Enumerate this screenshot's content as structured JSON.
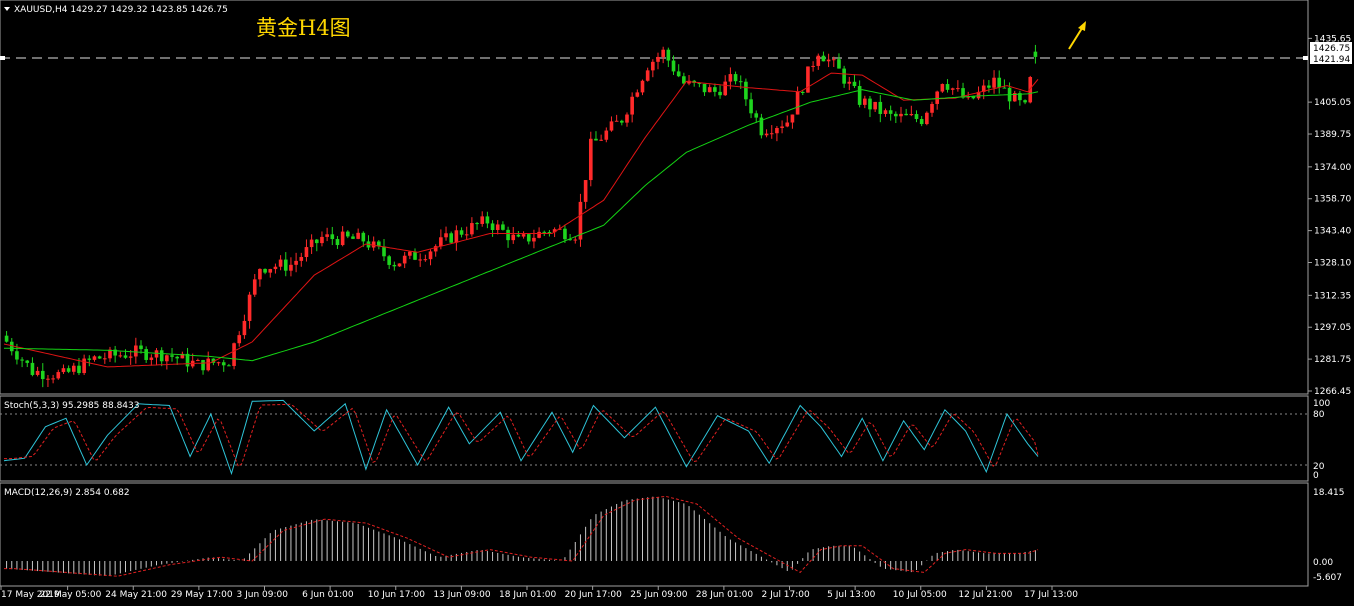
{
  "chart": {
    "symbol_line": "XAUUSD,H4  1429.27 1429.32 1423.85 1426.75",
    "title": "黄金H4图",
    "current_price": "1426.75",
    "line_price": "1421.94",
    "price_axis_labels": [
      "1435.65",
      "1405.05",
      "1389.75",
      "1374.00",
      "1358.70",
      "1343.40",
      "1328.10",
      "1312.35",
      "1297.05",
      "1281.75",
      "1266.45"
    ],
    "time_labels": [
      "17 May 2019",
      "22 May 05:00",
      "24 May 21:00",
      "29 May 17:00",
      "3 Jun 09:00",
      "6 Jun 01:00",
      "10 Jun 17:00",
      "13 Jun 09:00",
      "18 Jun 01:00",
      "20 Jun 17:00",
      "25 Jun 09:00",
      "28 Jun 01:00",
      "2 Jul 17:00",
      "5 Jul 13:00",
      "10 Jul 05:00",
      "12 Jul 21:00",
      "17 Jul 13:00"
    ]
  },
  "stoch": {
    "label": "Stoch(5,3,3) 95.2985 88.8433",
    "levels": [
      "100",
      "80",
      "20",
      "0"
    ]
  },
  "macd": {
    "label": "MACD(12,26,9) 2.854 0.682",
    "levels": [
      "18.415",
      "0.00",
      "-5.607"
    ]
  },
  "colors": {
    "background": "#000000",
    "bull_candle": "#ff2a2a",
    "bear_candle": "#1ed41e",
    "fast_ma": "#e01414",
    "slow_ma": "#14d414",
    "stoch_main": "#2ec4d8",
    "stoch_signal": "#e02020",
    "macd_hist": "#c8c8c8",
    "macd_signal": "#e02020",
    "title": "#ffd700",
    "arrow": "#ffd700"
  },
  "chart_data": {
    "type": "candlestick",
    "symbol": "XAUUSD",
    "timeframe": "H4",
    "ohlc_last": {
      "open": 1429.27,
      "high": 1429.32,
      "low": 1423.85,
      "close": 1426.75
    },
    "ylim": [
      1266.45,
      1443.5
    ],
    "close_path": [
      [
        0,
        1293
      ],
      [
        0.03,
        1276
      ],
      [
        0.06,
        1274
      ],
      [
        0.09,
        1282
      ],
      [
        0.13,
        1285
      ],
      [
        0.16,
        1284
      ],
      [
        0.19,
        1279
      ],
      [
        0.22,
        1281
      ],
      [
        0.25,
        1326
      ],
      [
        0.28,
        1327
      ],
      [
        0.31,
        1340
      ],
      [
        0.35,
        1339
      ],
      [
        0.38,
        1328
      ],
      [
        0.41,
        1333
      ],
      [
        0.44,
        1342
      ],
      [
        0.47,
        1348
      ],
      [
        0.5,
        1338
      ],
      [
        0.53,
        1344
      ],
      [
        0.555,
        1342
      ],
      [
        0.57,
        1384
      ],
      [
        0.6,
        1397
      ],
      [
        0.625,
        1423
      ],
      [
        0.64,
        1429
      ],
      [
        0.66,
        1414
      ],
      [
        0.69,
        1410
      ],
      [
        0.71,
        1417
      ],
      [
        0.735,
        1392
      ],
      [
        0.76,
        1396
      ],
      [
        0.79,
        1430
      ],
      [
        0.81,
        1420
      ],
      [
        0.83,
        1406
      ],
      [
        0.86,
        1398
      ],
      [
        0.89,
        1397
      ],
      [
        0.91,
        1416
      ],
      [
        0.935,
        1405
      ],
      [
        0.96,
        1415
      ],
      [
        0.98,
        1406
      ],
      [
        0.99,
        1402
      ],
      [
        1.0,
        1428
      ]
    ],
    "fast_ma_path": [
      [
        0,
        1289
      ],
      [
        0.1,
        1278
      ],
      [
        0.2,
        1280
      ],
      [
        0.24,
        1290
      ],
      [
        0.3,
        1322
      ],
      [
        0.35,
        1337
      ],
      [
        0.4,
        1333
      ],
      [
        0.47,
        1342
      ],
      [
        0.53,
        1342
      ],
      [
        0.58,
        1358
      ],
      [
        0.62,
        1388
      ],
      [
        0.66,
        1415
      ],
      [
        0.72,
        1412
      ],
      [
        0.77,
        1410
      ],
      [
        0.8,
        1419
      ],
      [
        0.83,
        1418
      ],
      [
        0.87,
        1406
      ],
      [
        0.92,
        1407
      ],
      [
        0.97,
        1413
      ],
      [
        0.99,
        1410
      ],
      [
        1.0,
        1416
      ]
    ],
    "slow_ma_path": [
      [
        0,
        1287
      ],
      [
        0.1,
        1286
      ],
      [
        0.2,
        1283
      ],
      [
        0.24,
        1281
      ],
      [
        0.3,
        1290
      ],
      [
        0.38,
        1306
      ],
      [
        0.46,
        1322
      ],
      [
        0.52,
        1334
      ],
      [
        0.58,
        1346
      ],
      [
        0.62,
        1365
      ],
      [
        0.66,
        1381
      ],
      [
        0.72,
        1394
      ],
      [
        0.78,
        1405
      ],
      [
        0.83,
        1411
      ],
      [
        0.88,
        1406
      ],
      [
        0.94,
        1408
      ],
      [
        0.99,
        1409
      ],
      [
        1.0,
        1410
      ]
    ],
    "stoch_main_path": [
      [
        0,
        25
      ],
      [
        0.02,
        28
      ],
      [
        0.04,
        65
      ],
      [
        0.06,
        75
      ],
      [
        0.08,
        20
      ],
      [
        0.1,
        55
      ],
      [
        0.13,
        92
      ],
      [
        0.16,
        90
      ],
      [
        0.18,
        30
      ],
      [
        0.2,
        80
      ],
      [
        0.22,
        10
      ],
      [
        0.24,
        95
      ],
      [
        0.27,
        96
      ],
      [
        0.3,
        60
      ],
      [
        0.33,
        92
      ],
      [
        0.35,
        15
      ],
      [
        0.37,
        85
      ],
      [
        0.4,
        20
      ],
      [
        0.43,
        88
      ],
      [
        0.45,
        45
      ],
      [
        0.48,
        82
      ],
      [
        0.5,
        25
      ],
      [
        0.53,
        82
      ],
      [
        0.55,
        35
      ],
      [
        0.57,
        90
      ],
      [
        0.6,
        52
      ],
      [
        0.63,
        88
      ],
      [
        0.66,
        18
      ],
      [
        0.69,
        78
      ],
      [
        0.72,
        60
      ],
      [
        0.74,
        22
      ],
      [
        0.77,
        90
      ],
      [
        0.79,
        65
      ],
      [
        0.81,
        30
      ],
      [
        0.83,
        75
      ],
      [
        0.85,
        25
      ],
      [
        0.87,
        72
      ],
      [
        0.89,
        38
      ],
      [
        0.91,
        85
      ],
      [
        0.93,
        60
      ],
      [
        0.95,
        12
      ],
      [
        0.97,
        80
      ],
      [
        0.99,
        45
      ],
      [
        1.0,
        30
      ],
      [
        1.01,
        100
      ]
    ],
    "macd_hist_path": [
      [
        0,
        -2
      ],
      [
        0.1,
        -4
      ],
      [
        0.15,
        -1
      ],
      [
        0.2,
        1
      ],
      [
        0.23,
        0
      ],
      [
        0.26,
        8
      ],
      [
        0.3,
        11
      ],
      [
        0.34,
        10
      ],
      [
        0.38,
        6
      ],
      [
        0.42,
        1
      ],
      [
        0.46,
        3
      ],
      [
        0.5,
        1
      ],
      [
        0.54,
        0
      ],
      [
        0.57,
        12
      ],
      [
        0.6,
        16
      ],
      [
        0.63,
        17
      ],
      [
        0.66,
        15
      ],
      [
        0.7,
        6
      ],
      [
        0.74,
        0
      ],
      [
        0.76,
        -3
      ],
      [
        0.78,
        3
      ],
      [
        0.8,
        4
      ],
      [
        0.82,
        4
      ],
      [
        0.85,
        -2
      ],
      [
        0.88,
        -3
      ],
      [
        0.9,
        2
      ],
      [
        0.92,
        3
      ],
      [
        0.95,
        2
      ],
      [
        0.98,
        2
      ],
      [
        1.0,
        3
      ]
    ]
  }
}
